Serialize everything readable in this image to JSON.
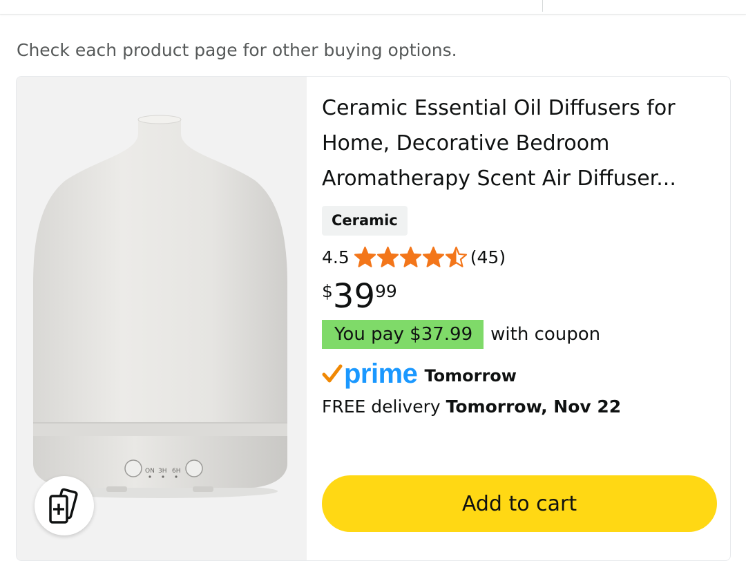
{
  "notice": "Check each product page for other buying options.",
  "product": {
    "title": "Ceramic Essential Oil Diffusers for Home, Decorative Bedroom Aromatherapy Scent Air Diffuser...",
    "variant": "Ceramic",
    "rating": "4.5",
    "rating_value": 4.5,
    "rating_max": 5,
    "review_count": "(45)",
    "price": {
      "symbol": "$",
      "whole": "39",
      "fraction": "99"
    },
    "coupon": {
      "badge": "You pay $37.99",
      "suffix": "with coupon"
    },
    "prime": {
      "label": "prime",
      "speed": "Tomorrow"
    },
    "delivery": {
      "prefix": "FREE delivery",
      "date": "Tomorrow, Nov 22"
    },
    "device_labels": [
      "ON",
      "3H",
      "6H"
    ],
    "add_to_cart_label": "Add to cart"
  },
  "icons": {
    "compare": "compare-cards-icon",
    "star": "star-icon",
    "prime_check": "prime-check-icon"
  },
  "colors": {
    "star": "#f3761a",
    "coupon_badge": "#7fda69",
    "prime_blue": "#1a98ff",
    "prime_check": "#f08804",
    "cart_button": "#ffd814"
  }
}
